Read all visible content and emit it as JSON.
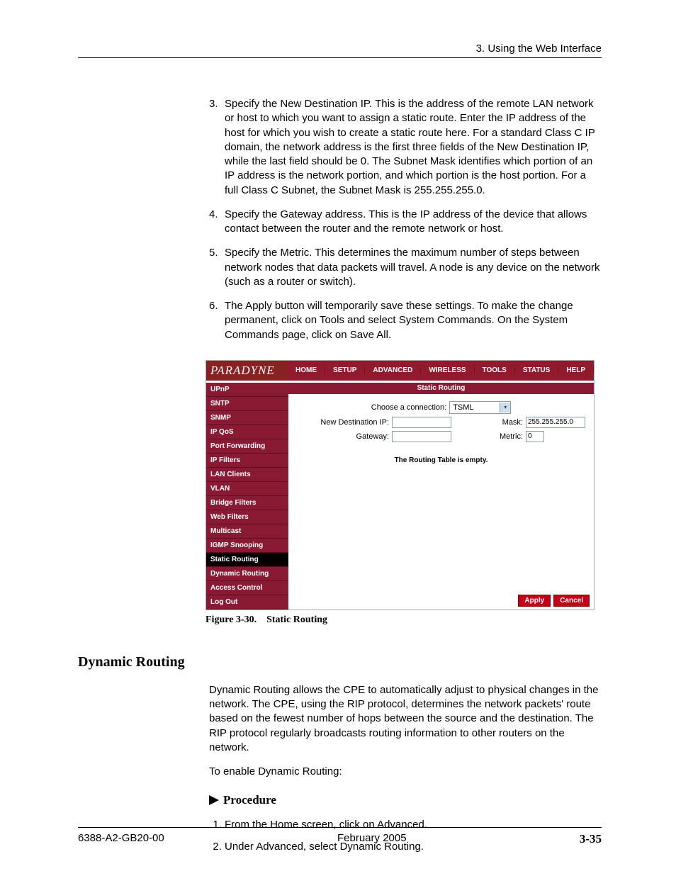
{
  "header": {
    "section": "3. Using the Web Interface"
  },
  "steps": {
    "s3": "Specify the New Destination IP. This is the address of the remote LAN network or host to which you want to assign a static route. Enter the IP address of the host for which you wish to create a static route here. For a standard Class C IP domain, the network address is the first three fields of the New Destination IP, while the last field should be 0. The Subnet Mask identifies which portion of an IP address is the network portion, and which portion is the host portion. For a full Class C Subnet, the Subnet Mask is 255.255.255.0.",
    "s4": "Specify the Gateway address. This is the IP address of the device that allows contact between the router and the remote network or host.",
    "s5": "Specify the Metric. This determines the maximum number of steps between network nodes that data packets will travel. A node is any device on the network (such as a router or switch).",
    "s6": "The Apply button will temporarily save these settings. To make the change permanent, click on Tools and select System Commands. On the System Commands page, click on Save All."
  },
  "ui": {
    "brand": "PARADYNE",
    "topnav": [
      "HOME",
      "SETUP",
      "ADVANCED",
      "WIRELESS",
      "TOOLS",
      "STATUS",
      "HELP"
    ],
    "sidebar": [
      "UPnP",
      "SNTP",
      "SNMP",
      "IP QoS",
      "Port Forwarding",
      "IP Filters",
      "LAN Clients",
      "VLAN",
      "Bridge Filters",
      "Web Filters",
      "Multicast",
      "IGMP Snooping",
      "Static Routing",
      "Dynamic Routing",
      "Access Control",
      "Log Out"
    ],
    "active_index": 12,
    "panel_title": "Static Routing",
    "labels": {
      "choose": "Choose a connection:",
      "conn_value": "TSML",
      "newdest": "New Destination IP:",
      "mask": "Mask:",
      "mask_value": "255.255.255.0",
      "gateway": "Gateway:",
      "metric": "Metric:",
      "metric_value": "0",
      "empty": "The Routing Table is empty."
    },
    "buttons": {
      "apply": "Apply",
      "cancel": "Cancel"
    }
  },
  "figcap": "Figure 3-30. Static Routing",
  "section_heading": "Dynamic Routing",
  "dyn_para": "Dynamic Routing allows the CPE to automatically adjust to physical changes in the network. The CPE, using the RIP protocol, determines the network packets' route based on the fewest number of hops between the source and the destination. The RIP protocol regularly broadcasts routing information to other routers on the network.",
  "dyn_enable": "To enable Dynamic Routing:",
  "procedure_label": "Procedure",
  "proc_steps": {
    "p1": "From the Home screen, click on Advanced.",
    "p2": "Under Advanced, select Dynamic Routing."
  },
  "footer": {
    "doc": "6388-A2-GB20-00",
    "date": "February 2005",
    "page": "3-35"
  }
}
